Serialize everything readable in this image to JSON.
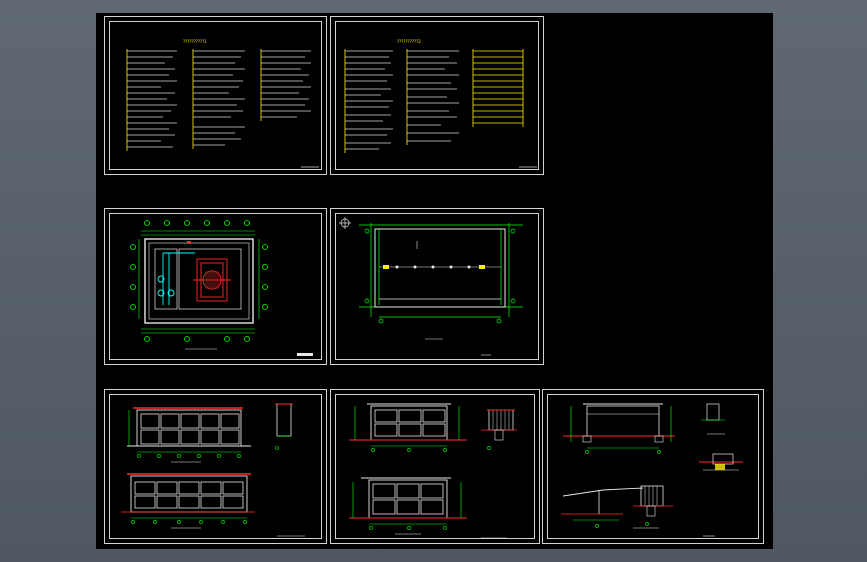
{
  "viewport": {
    "background": "#000000",
    "frame_color": "#5a636d"
  },
  "colors": {
    "line": "#e8e8e8",
    "green": "#00ff00",
    "red": "#ff2a2a",
    "cyan": "#00ffff",
    "yellow": "#ffee00",
    "white": "#ffffff"
  },
  "sheets": [
    {
      "id": "notes-1",
      "title": "??????????1"
    },
    {
      "id": "notes-2",
      "title": "??????????2"
    },
    {
      "id": "floor-plan",
      "title": ""
    },
    {
      "id": "foundation-plan",
      "title": ""
    },
    {
      "id": "elevations-a",
      "title": ""
    },
    {
      "id": "elevations-b",
      "title": ""
    },
    {
      "id": "sections",
      "title": ""
    }
  ]
}
